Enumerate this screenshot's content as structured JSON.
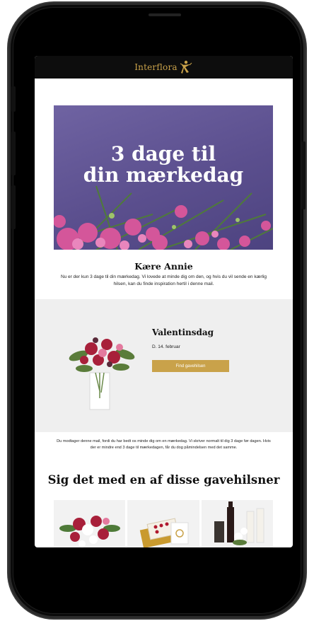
{
  "brand": {
    "name": "Interflora",
    "color": "#c9a24a"
  },
  "hero": {
    "title": "3 dage til\ndin mærkedag"
  },
  "greeting": "Kære Annie",
  "intro": "Nu er der kun 3 dage til din mærkedag. Vi lovede at minde dig om den, og hvis du vil sende en kærlig hilsen, kan du finde inspiration hertil i denne mail.",
  "occasion": {
    "title": "Valentinsdag",
    "date": "D. 14. februar",
    "button": "Find gavehilsen"
  },
  "notice": "Du modtager denne mail, fordi du har bedt os minde dig om en mærkedag. Vi skriver normalt til dig 3 dage før dagen. Hvis der er mindre end 3 dage til mærkedagen, får du dog påmindelsen med det samme.",
  "section": {
    "title": "Sig det med en af disse gavehilsner"
  },
  "products": [
    {
      "icon": "bouquet-image"
    },
    {
      "icon": "chocolate-box-image"
    },
    {
      "icon": "gift-basket-image"
    }
  ]
}
